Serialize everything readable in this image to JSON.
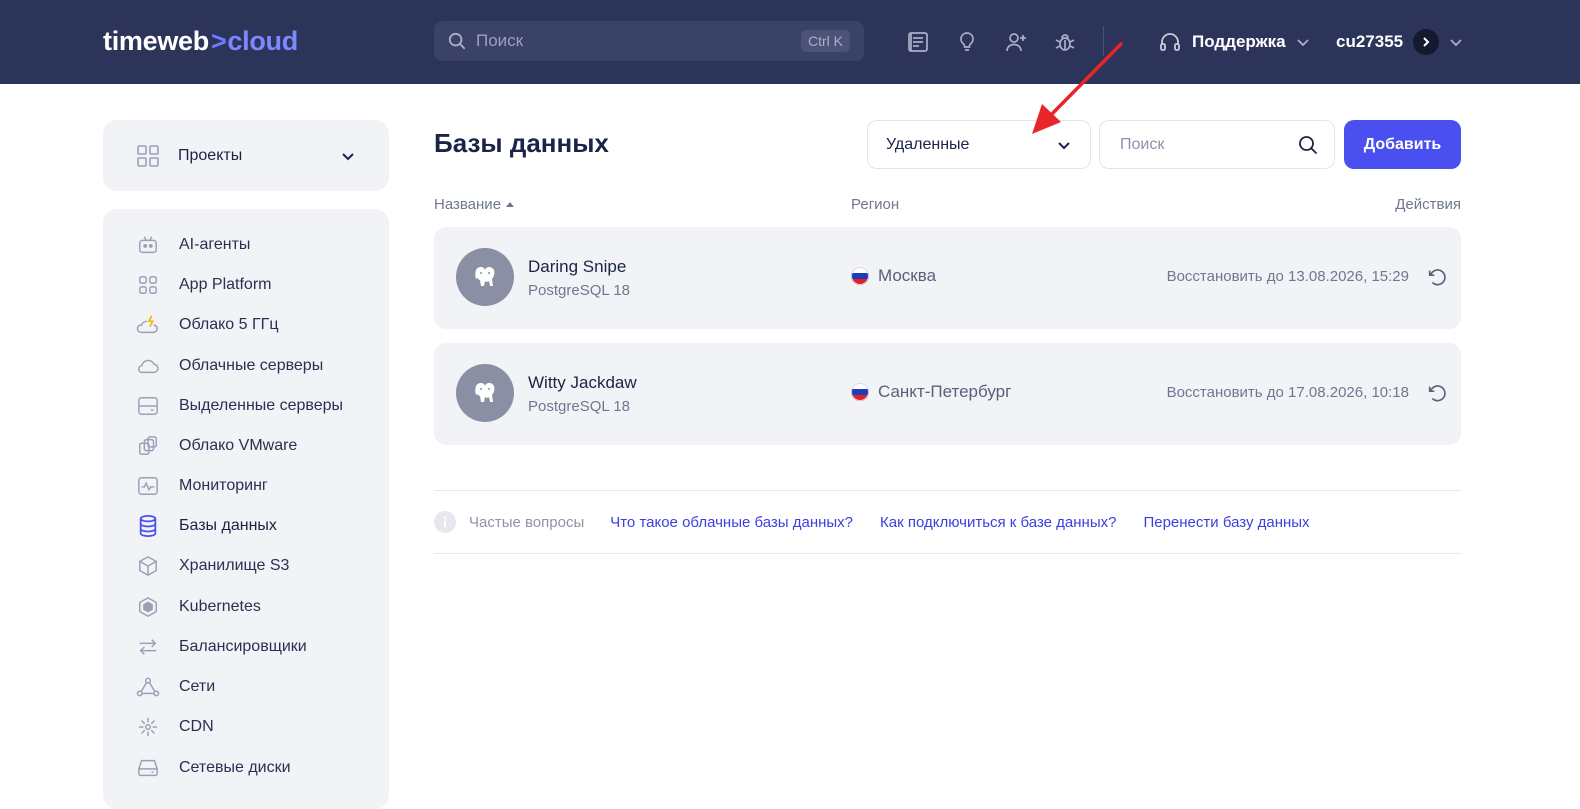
{
  "header": {
    "logo_main": "timeweb",
    "logo_mark": ">",
    "logo_suffix": "cloud",
    "search_placeholder": "Поиск",
    "search_shortcut": "Ctrl K",
    "icons": [
      "docs-icon",
      "lightbulb-icon",
      "add-user-icon",
      "bug-icon"
    ],
    "support_label": "Поддержка",
    "user_name": "cu27355"
  },
  "sidebar": {
    "projects_label": "Проекты",
    "items": [
      {
        "label": "AI-агенты",
        "icon": "ai-agent-icon"
      },
      {
        "label": "App Platform",
        "icon": "app-platform-icon"
      },
      {
        "label": "Облако 5 ГГц",
        "icon": "cloud-lightning-icon"
      },
      {
        "label": "Облачные серверы",
        "icon": "cloud-icon"
      },
      {
        "label": "Выделенные серверы",
        "icon": "server-icon"
      },
      {
        "label": "Облако VMware",
        "icon": "vmware-icon"
      },
      {
        "label": "Мониторинг",
        "icon": "monitoring-icon"
      },
      {
        "label": "Базы данных",
        "icon": "database-icon"
      },
      {
        "label": "Хранилище S3",
        "icon": "storage-cube-icon"
      },
      {
        "label": "Kubernetes",
        "icon": "kubernetes-icon"
      },
      {
        "label": "Балансировщики",
        "icon": "balancer-icon"
      },
      {
        "label": "Сети",
        "icon": "network-icon"
      },
      {
        "label": "CDN",
        "icon": "cdn-icon"
      },
      {
        "label": "Сетевые диски",
        "icon": "disk-icon"
      }
    ],
    "active_index": 7,
    "accent_color": "#4a50f0"
  },
  "main": {
    "title": "Базы данных",
    "filter_value": "Удаленные",
    "search_placeholder": "Поиск",
    "add_label": "Добавить",
    "columns": {
      "name": "Название",
      "region": "Регион",
      "actions": "Действия"
    },
    "rows": [
      {
        "name": "Daring Snipe",
        "engine": "PostgreSQL 18",
        "region": "Москва",
        "restore": "Восстановить до 13.08.2026, 15:29"
      },
      {
        "name": "Witty Jackdaw",
        "engine": "PostgreSQL 18",
        "region": "Санкт-Петербург",
        "restore": "Восстановить до 17.08.2026, 10:18"
      }
    ],
    "faq": {
      "label": "Частые вопросы",
      "links": [
        "Что такое облачные базы данных?",
        "Как подключиться к базе данных?",
        "Перенести базу данных"
      ]
    }
  },
  "colors": {
    "header_bg": "#2c3459",
    "primary": "#4a50f0",
    "link": "#3a3fe0",
    "annotation_arrow": "#e8252b"
  }
}
